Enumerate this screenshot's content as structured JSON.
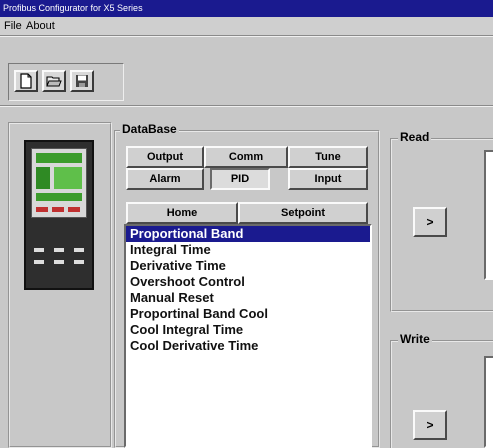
{
  "window": {
    "title": "Profibus Configurator for X5 Series"
  },
  "menu": [
    {
      "label": "File"
    },
    {
      "label": "About"
    }
  ],
  "toolbar": {
    "buttons": [
      "new-file-icon",
      "open-folder-icon",
      "save-icon"
    ]
  },
  "database": {
    "label": "DataBase",
    "tabs_row1": [
      "Output",
      "Comm",
      "Tune"
    ],
    "tabs_row2": [
      "Alarm",
      "PID",
      "Input"
    ],
    "tabs_row3": [
      "Home",
      "Setpoint"
    ],
    "active_tab": "PID",
    "items": [
      "Proportional Band",
      "Integral Time",
      "Derivative Time",
      "Overshoot Control",
      "Manual Reset",
      "Proportinal Band Cool",
      "Cool Integral Time",
      "Cool Derivative Time"
    ],
    "selected_index": 0
  },
  "read": {
    "label": "Read",
    "button": ">"
  },
  "write": {
    "label": "Write",
    "button": ">"
  }
}
